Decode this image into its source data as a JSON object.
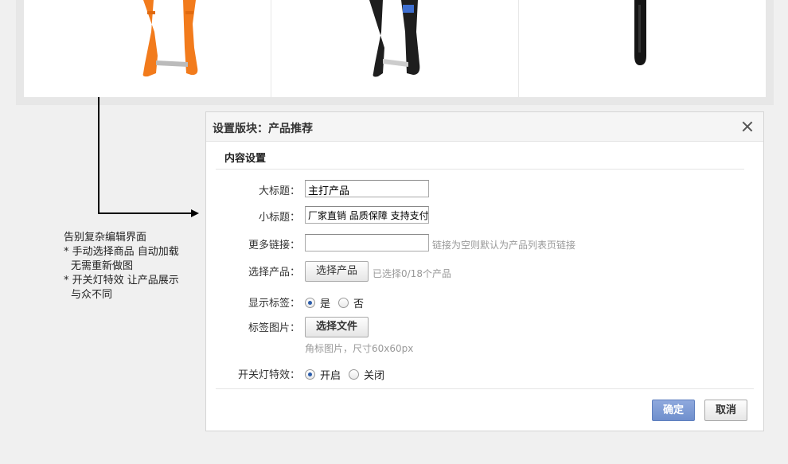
{
  "products": [
    {
      "icon": "orange-rivet-gun-image",
      "color": "#f27b1c"
    },
    {
      "icon": "black-rivet-gun-image",
      "color": "#1e1e1e"
    },
    {
      "icon": "black-tool-handle-image",
      "color": "#151515"
    }
  ],
  "annotation": {
    "lines": [
      "告别复杂编辑界面",
      "* 手动选择商品 自动加载",
      "无需重新做图",
      "* 开关灯特效 让产品展示",
      "与众不同"
    ]
  },
  "dialog": {
    "title": "设置版块：产品推荐",
    "section_title": "内容设置",
    "main_title": {
      "label": "大标题：",
      "value": "主打产品"
    },
    "sub_title": {
      "label": "小标题：",
      "value": "厂家直销 品质保障 支持支付"
    },
    "more_link": {
      "label": "更多链接：",
      "value": "",
      "hint": "链接为空则默认为产品列表页链接"
    },
    "select_product": {
      "label": "选择产品：",
      "button": "选择产品",
      "hint": "已选择0/18个产品"
    },
    "show_tag": {
      "label": "显示标签：",
      "options": [
        "是",
        "否"
      ],
      "selected": "是"
    },
    "tag_image": {
      "label": "标签图片：",
      "button": "选择文件",
      "hint": "角标图片，尺寸60x60px"
    },
    "light_effect": {
      "label": "开关灯特效：",
      "options": [
        "开启",
        "关闭"
      ],
      "selected": "开启"
    },
    "ok_button": "确定",
    "cancel_button": "取消"
  },
  "colors": {
    "accent_button": "#7b98d3",
    "radio_dot": "#2b5caa"
  }
}
